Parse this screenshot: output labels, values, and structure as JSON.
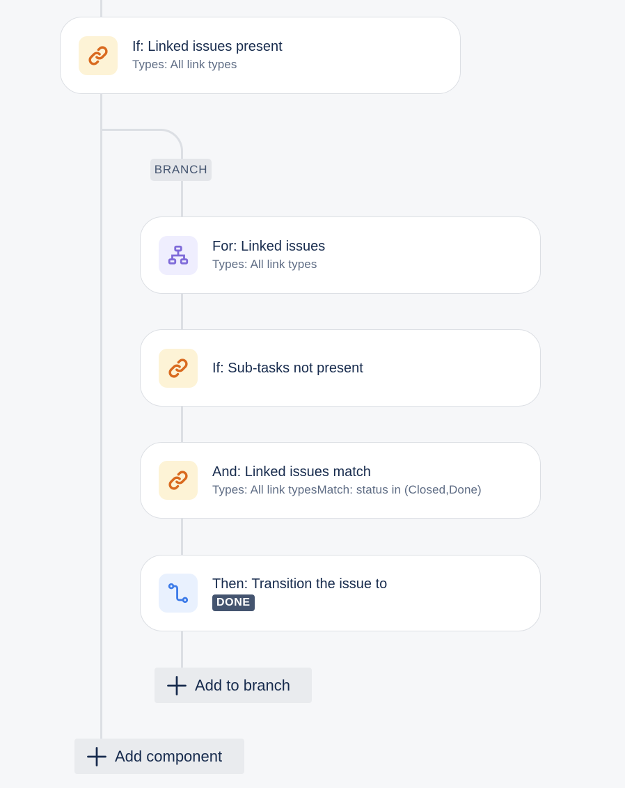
{
  "colors": {
    "background": "#f6f7f9",
    "card_border": "#dcdfe4",
    "connector": "#dcdfe4",
    "icon_orange_bg": "#fdf3d6",
    "icon_orange_fg": "#d96a1f",
    "icon_purple_bg": "#efeefe",
    "icon_purple_fg": "#7f6bd9",
    "icon_blue_bg": "#e9f1fe",
    "icon_blue_fg": "#3d7be8",
    "lozenge_bg": "#44546f"
  },
  "components": [
    {
      "icon": "link-icon",
      "title": "If: Linked issues present",
      "subtitle": "Types: All link types"
    }
  ],
  "branch": {
    "tag": "BRANCH",
    "components": [
      {
        "icon": "hierarchy-icon",
        "title": "For: Linked issues",
        "subtitle": "Types: All link types"
      },
      {
        "icon": "link-icon",
        "title": "If: Sub-tasks not present"
      },
      {
        "icon": "link-icon",
        "title": "And: Linked issues match",
        "subtitle": "Types: All link typesMatch: status in (Closed,Done)"
      },
      {
        "icon": "transition-icon",
        "title": "Then: Transition the issue to",
        "status_lozenge": "DONE"
      }
    ],
    "add_label": "Add to branch"
  },
  "add_component_label": "Add component"
}
